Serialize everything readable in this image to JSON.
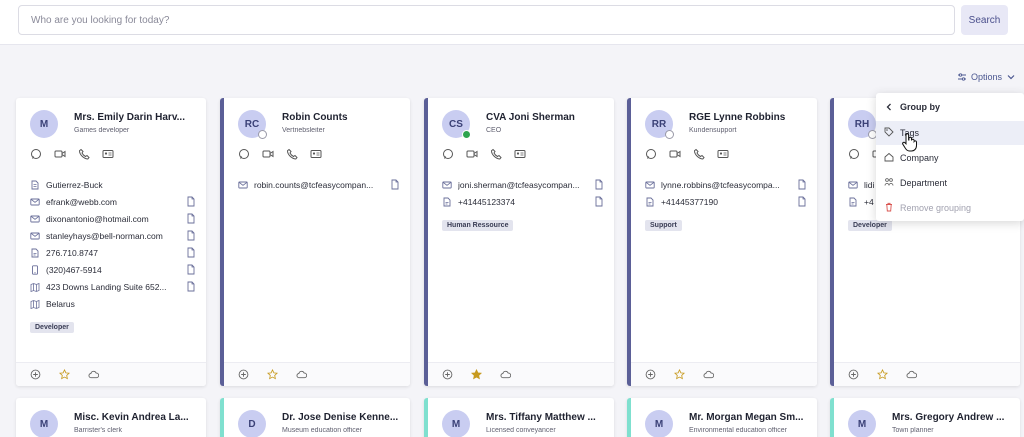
{
  "search": {
    "placeholder": "Who are you looking for today?",
    "button": "Search"
  },
  "options": {
    "label": "Options"
  },
  "colors": {
    "accent": "#5b5f97",
    "teal": "#7fe0cf",
    "avatar": "#c9cdf1",
    "star": "#c79a1e",
    "danger": "#d9534f"
  },
  "icons": {
    "actions": [
      "chat-icon",
      "video-icon",
      "phone-icon",
      "contact-card-icon"
    ],
    "footer": [
      "add-icon",
      "star-icon",
      "cloud-icon"
    ]
  },
  "cards": [
    {
      "initials": "M",
      "name": "Mrs. Emily Darin Harv...",
      "role": "Games developer",
      "rows": [
        {
          "icon": "company-icon",
          "text": "Gutierrez-Buck"
        },
        {
          "icon": "mail-icon",
          "text": "efrank@webb.com"
        },
        {
          "icon": "mail-icon",
          "text": "dixonantonio@hotmail.com"
        },
        {
          "icon": "mail-icon",
          "text": "stanleyhays@bell-norman.com"
        },
        {
          "icon": "phone-doc-icon",
          "text": "276.710.8747"
        },
        {
          "icon": "mobile-icon",
          "text": "(320)467-5914"
        },
        {
          "icon": "map-icon",
          "text": "423 Downs Landing Suite 652..."
        },
        {
          "icon": "map-icon",
          "text": "Belarus"
        }
      ],
      "tag": "Developer"
    },
    {
      "initials": "RC",
      "name": "Robin Counts",
      "role": "Vertriebsleiter",
      "rows": [
        {
          "icon": "mail-icon",
          "text": "robin.counts@tcfeasycompan..."
        }
      ],
      "tag": ""
    },
    {
      "initials": "CS",
      "name": "CVA Joni Sherman",
      "role": "CEO",
      "rows": [
        {
          "icon": "mail-icon",
          "text": "joni.sherman@tcfeasycompan..."
        },
        {
          "icon": "phone-doc-icon",
          "text": "+41445123374"
        }
      ],
      "tag": "Human Ressource"
    },
    {
      "initials": "RR",
      "name": "RGE Lynne Robbins",
      "role": "Kundensupport",
      "rows": [
        {
          "icon": "mail-icon",
          "text": "lynne.robbins@tcfeasycompa..."
        },
        {
          "icon": "phone-doc-icon",
          "text": "+41445377190"
        }
      ],
      "tag": "Support"
    },
    {
      "initials": "RH",
      "name": "",
      "role": "",
      "rows": [
        {
          "icon": "mail-icon",
          "text": "lidi"
        },
        {
          "icon": "phone-doc-icon",
          "text": "+4"
        }
      ],
      "tag": "Developer"
    }
  ],
  "bottom_cards": [
    {
      "initials": "M",
      "name": "Misc. Kevin Andrea La...",
      "role": "Barrister's clerk"
    },
    {
      "initials": "D",
      "name": "Dr. Jose Denise Kenne...",
      "role": "Museum education officer"
    },
    {
      "initials": "M",
      "name": "Mrs. Tiffany Matthew ...",
      "role": "Licensed conveyancer"
    },
    {
      "initials": "M",
      "name": "Mr. Morgan Megan Sm...",
      "role": "Environmental education officer"
    },
    {
      "initials": "M",
      "name": "Mrs. Gregory Andrew ...",
      "role": "Town planner"
    }
  ],
  "dropdown": {
    "header": "Group by",
    "items": [
      {
        "label": "Tags",
        "icon": "tag-icon",
        "state": "hover"
      },
      {
        "label": "Company",
        "icon": "home-icon",
        "state": "normal"
      },
      {
        "label": "Department",
        "icon": "department-icon",
        "state": "normal"
      },
      {
        "label": "Remove grouping",
        "icon": "trash-icon",
        "state": "disabled"
      }
    ]
  }
}
